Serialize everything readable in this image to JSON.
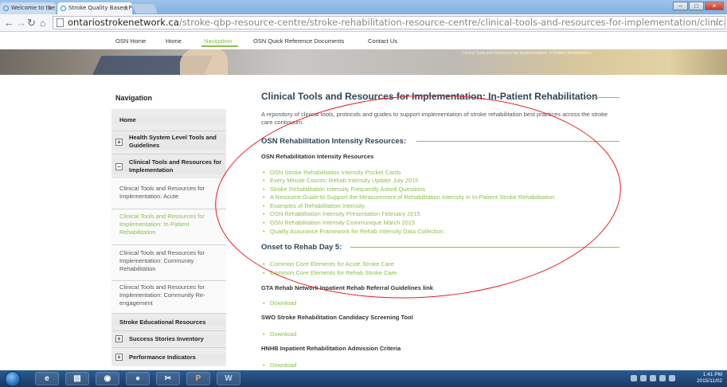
{
  "browser": {
    "tabs": [
      {
        "label": "Welcome to the Ontario S",
        "active": false
      },
      {
        "label": "Stroke Quality Based Proc",
        "active": true
      }
    ],
    "url_host": "ontariostrokenetwork.ca",
    "url_path": "/stroke-qbp-resource-centre/stroke-rehabilitation-resource-centre/clinical-tools-and-resources-for-implementation/clinical-tools-resources-implementation-patient-rehabilita"
  },
  "site_nav": {
    "items": [
      "OSN Home",
      "Home",
      "Navigation",
      "OSN Quick Reference Documents",
      "Contact Us"
    ],
    "active": "Navigation",
    "accent": "#8cc04a"
  },
  "banner": {
    "caption": "Clinical Tools and Resources for Implementation: In-Patient Rehabilitation"
  },
  "sidebar": {
    "title": "Navigation",
    "items": [
      {
        "label": "Home",
        "kind": "section",
        "toggle": ""
      },
      {
        "label": "Health System Level Tools and Guidelines",
        "kind": "section",
        "toggle": "+"
      },
      {
        "label": "Clinical Tools and Resources for Implementation",
        "kind": "section",
        "toggle": "−"
      },
      {
        "label": "Clinical Tools and Resources for Implementation: Acute",
        "kind": "sub"
      },
      {
        "label": "Clinical Tools and Resources for Implementation: In-Patient Rehabilitation",
        "kind": "sub",
        "active": true
      },
      {
        "label": "Clinical Tools and Resources for Implementation: Community Rehabilitation",
        "kind": "sub"
      },
      {
        "label": "Clinical Tools and Resources for Implementation: Community Re-engagement",
        "kind": "sub"
      },
      {
        "label": "Stroke Educational Resources",
        "kind": "section",
        "toggle": ""
      },
      {
        "label": "Success Stories Inventory",
        "kind": "section",
        "toggle": "+"
      },
      {
        "label": "Performance Indicators",
        "kind": "section",
        "toggle": "+"
      }
    ]
  },
  "main": {
    "title": "Clinical Tools and Resources for Implementation: In-Patient Rehabilitation",
    "intro": "A repository of clinical tools, protocols and guides to support implementation of stroke rehabilitation best practices across the stroke care continuum.",
    "sections": [
      {
        "heading": "OSN Rehabilitation Intensity Resources:",
        "subheading": "OSN Rehabilitation Intensity Resources",
        "links": [
          "OSN Stroke Rehabilitation Intensity Pocket Cards",
          "Every Minute Counts: Rehab Intensity Update July 2015",
          "Stroke Rehabilitation Intensity Frequently Asked Questions",
          "A Resource Guide to Support the Measurement of Rehabilitation Intensity in In-Patient Stroke Rehabilitation",
          "Examples of Rehabilitation Intensity",
          "OSN Rehabilitation Intensity Presentation February 2015",
          "OSN Rehabilitation Intensity Communique March 2015",
          "Quality Assurance Framework for Rehab Intensity Data Collection"
        ]
      },
      {
        "heading": "Onset to Rehab Day 5:",
        "links": [
          "Common Core Elements for Acute Stroke Care",
          "Common Core Elements for Rehab Stroke Care"
        ]
      }
    ],
    "downloads": [
      {
        "heading": "GTA Rehab Network Inpatient Rehab Referral Guidelines link",
        "link": "Download"
      },
      {
        "heading": "SWO Stroke Rehabilitation Candidacy Screening Tool",
        "link": "Download"
      },
      {
        "heading": "HNHB Inpatient Rehabilitation Admission Criteria",
        "link": "Download"
      }
    ]
  },
  "annotation": {
    "color": "#e51b1b"
  },
  "taskbar": {
    "apps": [
      "IE",
      "Folder",
      "Chrome",
      "Firefox",
      "Snip",
      "PowerPoint",
      "Word"
    ],
    "app_glyphs": [
      "e",
      "▤",
      "◉",
      "●",
      "✂",
      "P",
      "W"
    ],
    "time": "1:41 PM",
    "date": "2015/11/02"
  }
}
